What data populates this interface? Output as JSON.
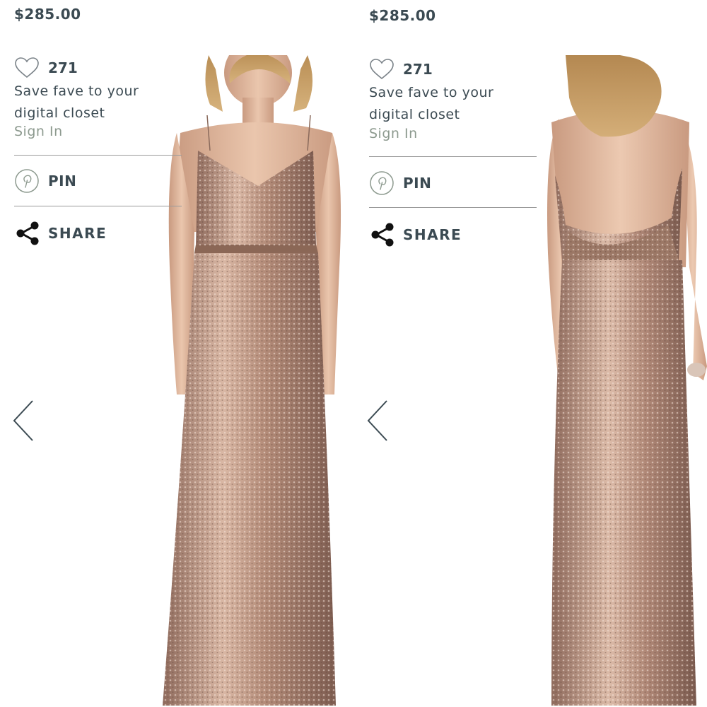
{
  "panels": [
    {
      "price": "$285.00",
      "fave_count": "271",
      "save_text": "Save fave to your digital closet",
      "sign_in": "Sign In",
      "pin_label": "PIN",
      "share_label": "SHARE",
      "icons": {
        "heart": "heart-outline-icon",
        "pin": "pinterest-icon",
        "share": "share-icon",
        "prev": "chevron-left-icon"
      }
    },
    {
      "price": "$285.00",
      "fave_count": "271",
      "save_text": "Save fave to your digital closet",
      "sign_in": "Sign In",
      "pin_label": "PIN",
      "share_label": "SHARE",
      "icons": {
        "heart": "heart-outline-icon",
        "pin": "pinterest-icon",
        "share": "share-icon",
        "prev": "chevron-left-icon"
      }
    }
  ],
  "colors": {
    "text": "#3b4a52",
    "sign_in": "#8d9a8f",
    "dress": "#b48a75",
    "skin": "#e3bca3"
  }
}
